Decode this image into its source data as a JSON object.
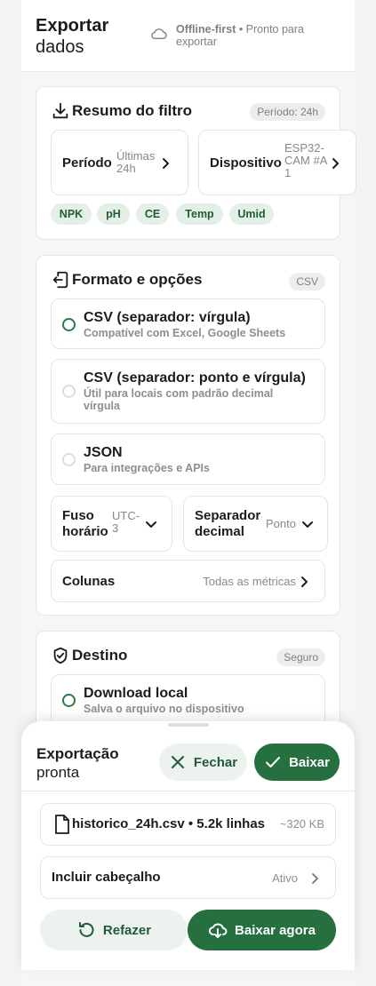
{
  "header": {
    "title_line1": "Exportar",
    "title_line2": "dados",
    "status_bold": "Offline-first",
    "status_rest": " • Pronto para exportar",
    "status_icon": "cloud-icon"
  },
  "filter": {
    "title": "Resumo do filtro",
    "badge": "Período: 24h",
    "period": {
      "label": "Período",
      "value": "Últimas 24h"
    },
    "device": {
      "label": "Dispositivo",
      "value": "ESP32-CAM #A1"
    },
    "metrics": [
      "NPK",
      "pH",
      "CE",
      "Temp",
      "Umid"
    ]
  },
  "format": {
    "title": "Formato e opções",
    "badge": "CSV",
    "options": [
      {
        "title": "CSV (separador: vírgula)",
        "subtitle": "Compatível com Excel, Google Sheets",
        "selected": true
      },
      {
        "title": "CSV (separador: ponto e vírgula)",
        "subtitle": "Útil para locais com padrão decimal vírgula",
        "selected": false
      },
      {
        "title": "JSON",
        "subtitle": "Para integrações e APIs",
        "selected": false
      }
    ],
    "timezone": {
      "label": "Fuso horário",
      "value": "UTC-3"
    },
    "decimal": {
      "label": "Separador decimal",
      "value": "Ponto"
    },
    "columns": {
      "label": "Colunas",
      "value": "Todas as métricas"
    }
  },
  "destination": {
    "title": "Destino",
    "badge": "Seguro",
    "option": {
      "title": "Download local",
      "subtitle": "Salva o arquivo no dispositivo",
      "selected": true
    }
  },
  "sheet": {
    "title_line1": "Exportação",
    "title_line2": "pronta",
    "close_label": "Fechar",
    "download_label": "Baixar",
    "file_name": "historico_24h.csv • 5.2k linhas",
    "file_size": "~320 KB",
    "include_header": {
      "label": "Incluir cabeçalho",
      "value": "Ativo"
    },
    "redo_label": "Refazer",
    "download_now_label": "Baixar agora"
  },
  "colors": {
    "accent": "#266f3f",
    "accent_soft": "#ecf3ee",
    "chip_bg": "#e4f0e7"
  }
}
